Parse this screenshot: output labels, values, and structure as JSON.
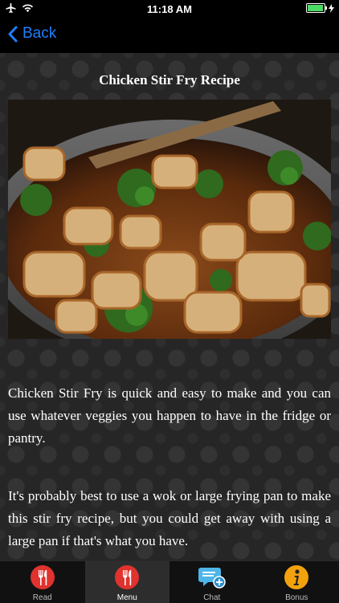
{
  "status_bar": {
    "time": "11:18 AM"
  },
  "nav": {
    "back_label": "Back"
  },
  "page": {
    "title": "Chicken Stir Fry Recipe",
    "paragraphs": [
      "Chicken Stir Fry is quick and easy to make and you can use whatever veggies you happen to have in the fridge or pantry.",
      "It's probably best to use a wok or large frying pan to make this stir fry recipe, but you could get away with using a large pan if that's what you have."
    ]
  },
  "tab_bar": {
    "items": [
      {
        "label": "Read",
        "icon": "fork-knife-icon",
        "color": "#e0332e"
      },
      {
        "label": "Menu",
        "icon": "fork-knife-icon",
        "color": "#e0332e"
      },
      {
        "label": "Chat",
        "icon": "chat-bubble-plus-icon",
        "color": "#4db6e8"
      },
      {
        "label": "Bonus",
        "icon": "info-icon",
        "color": "#f2a20c"
      }
    ],
    "selected": "Menu"
  },
  "colors": {
    "accent": "#1f7ffb",
    "battery": "#4cd964"
  }
}
